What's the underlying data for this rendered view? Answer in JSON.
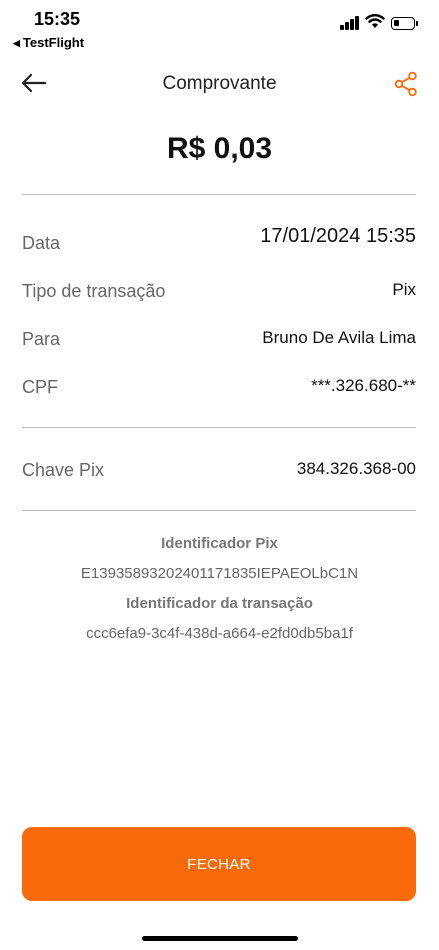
{
  "status_bar": {
    "time": "15:35",
    "back_app": "TestFlight"
  },
  "header": {
    "title": "Comprovante"
  },
  "amount": "R$ 0,03",
  "details": {
    "date_label": "Data",
    "date_value": "17/01/2024 15:35",
    "type_label": "Tipo de transação",
    "type_value": "Pix",
    "to_label": "Para",
    "to_value": "Bruno De Avila Lima",
    "cpf_label": "CPF",
    "cpf_value": "***.326.680-**",
    "pix_key_label": "Chave Pix",
    "pix_key_value": "384.326.368-00"
  },
  "identifiers": {
    "pix_id_label": "Identificador Pix",
    "pix_id_value": "E13935893202401171835IEPAEOLbC1N",
    "transaction_id_label": "Identificador da transação",
    "transaction_id_value": "ccc6efa9-3c4f-438d-a664-e2fd0db5ba1f"
  },
  "footer": {
    "close_label": "FECHAR"
  },
  "colors": {
    "accent": "#f96b0a",
    "divider": "#bdbdbd"
  }
}
